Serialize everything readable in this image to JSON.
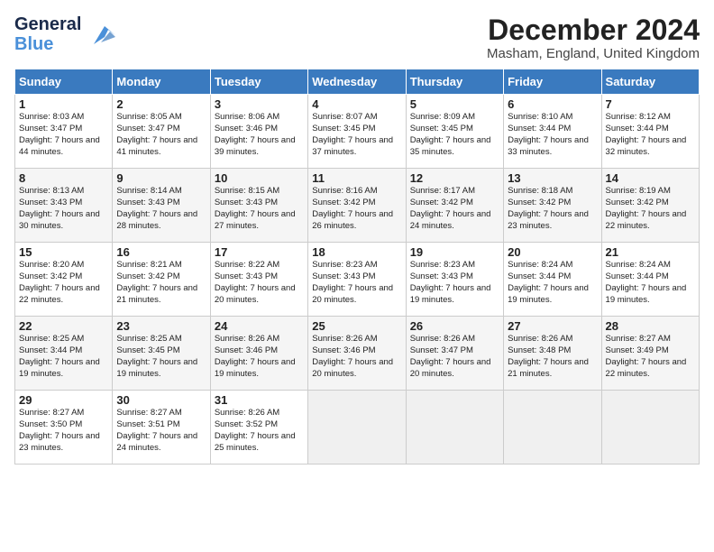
{
  "header": {
    "logo_line1": "General",
    "logo_line2": "Blue",
    "month_title": "December 2024",
    "location": "Masham, England, United Kingdom"
  },
  "days_of_week": [
    "Sunday",
    "Monday",
    "Tuesday",
    "Wednesday",
    "Thursday",
    "Friday",
    "Saturday"
  ],
  "weeks": [
    [
      {
        "day": "1",
        "sunrise": "8:03 AM",
        "sunset": "3:47 PM",
        "daylight": "7 hours and 44 minutes."
      },
      {
        "day": "2",
        "sunrise": "8:05 AM",
        "sunset": "3:47 PM",
        "daylight": "7 hours and 41 minutes."
      },
      {
        "day": "3",
        "sunrise": "8:06 AM",
        "sunset": "3:46 PM",
        "daylight": "7 hours and 39 minutes."
      },
      {
        "day": "4",
        "sunrise": "8:07 AM",
        "sunset": "3:45 PM",
        "daylight": "7 hours and 37 minutes."
      },
      {
        "day": "5",
        "sunrise": "8:09 AM",
        "sunset": "3:45 PM",
        "daylight": "7 hours and 35 minutes."
      },
      {
        "day": "6",
        "sunrise": "8:10 AM",
        "sunset": "3:44 PM",
        "daylight": "7 hours and 33 minutes."
      },
      {
        "day": "7",
        "sunrise": "8:12 AM",
        "sunset": "3:44 PM",
        "daylight": "7 hours and 32 minutes."
      }
    ],
    [
      {
        "day": "8",
        "sunrise": "8:13 AM",
        "sunset": "3:43 PM",
        "daylight": "7 hours and 30 minutes."
      },
      {
        "day": "9",
        "sunrise": "8:14 AM",
        "sunset": "3:43 PM",
        "daylight": "7 hours and 28 minutes."
      },
      {
        "day": "10",
        "sunrise": "8:15 AM",
        "sunset": "3:43 PM",
        "daylight": "7 hours and 27 minutes."
      },
      {
        "day": "11",
        "sunrise": "8:16 AM",
        "sunset": "3:42 PM",
        "daylight": "7 hours and 26 minutes."
      },
      {
        "day": "12",
        "sunrise": "8:17 AM",
        "sunset": "3:42 PM",
        "daylight": "7 hours and 24 minutes."
      },
      {
        "day": "13",
        "sunrise": "8:18 AM",
        "sunset": "3:42 PM",
        "daylight": "7 hours and 23 minutes."
      },
      {
        "day": "14",
        "sunrise": "8:19 AM",
        "sunset": "3:42 PM",
        "daylight": "7 hours and 22 minutes."
      }
    ],
    [
      {
        "day": "15",
        "sunrise": "8:20 AM",
        "sunset": "3:42 PM",
        "daylight": "7 hours and 22 minutes."
      },
      {
        "day": "16",
        "sunrise": "8:21 AM",
        "sunset": "3:42 PM",
        "daylight": "7 hours and 21 minutes."
      },
      {
        "day": "17",
        "sunrise": "8:22 AM",
        "sunset": "3:43 PM",
        "daylight": "7 hours and 20 minutes."
      },
      {
        "day": "18",
        "sunrise": "8:23 AM",
        "sunset": "3:43 PM",
        "daylight": "7 hours and 20 minutes."
      },
      {
        "day": "19",
        "sunrise": "8:23 AM",
        "sunset": "3:43 PM",
        "daylight": "7 hours and 19 minutes."
      },
      {
        "day": "20",
        "sunrise": "8:24 AM",
        "sunset": "3:44 PM",
        "daylight": "7 hours and 19 minutes."
      },
      {
        "day": "21",
        "sunrise": "8:24 AM",
        "sunset": "3:44 PM",
        "daylight": "7 hours and 19 minutes."
      }
    ],
    [
      {
        "day": "22",
        "sunrise": "8:25 AM",
        "sunset": "3:44 PM",
        "daylight": "7 hours and 19 minutes."
      },
      {
        "day": "23",
        "sunrise": "8:25 AM",
        "sunset": "3:45 PM",
        "daylight": "7 hours and 19 minutes."
      },
      {
        "day": "24",
        "sunrise": "8:26 AM",
        "sunset": "3:46 PM",
        "daylight": "7 hours and 19 minutes."
      },
      {
        "day": "25",
        "sunrise": "8:26 AM",
        "sunset": "3:46 PM",
        "daylight": "7 hours and 20 minutes."
      },
      {
        "day": "26",
        "sunrise": "8:26 AM",
        "sunset": "3:47 PM",
        "daylight": "7 hours and 20 minutes."
      },
      {
        "day": "27",
        "sunrise": "8:26 AM",
        "sunset": "3:48 PM",
        "daylight": "7 hours and 21 minutes."
      },
      {
        "day": "28",
        "sunrise": "8:27 AM",
        "sunset": "3:49 PM",
        "daylight": "7 hours and 22 minutes."
      }
    ],
    [
      {
        "day": "29",
        "sunrise": "8:27 AM",
        "sunset": "3:50 PM",
        "daylight": "7 hours and 23 minutes."
      },
      {
        "day": "30",
        "sunrise": "8:27 AM",
        "sunset": "3:51 PM",
        "daylight": "7 hours and 24 minutes."
      },
      {
        "day": "31",
        "sunrise": "8:26 AM",
        "sunset": "3:52 PM",
        "daylight": "7 hours and 25 minutes."
      },
      null,
      null,
      null,
      null
    ]
  ],
  "labels": {
    "sunrise": "Sunrise:",
    "sunset": "Sunset:",
    "daylight": "Daylight:"
  }
}
